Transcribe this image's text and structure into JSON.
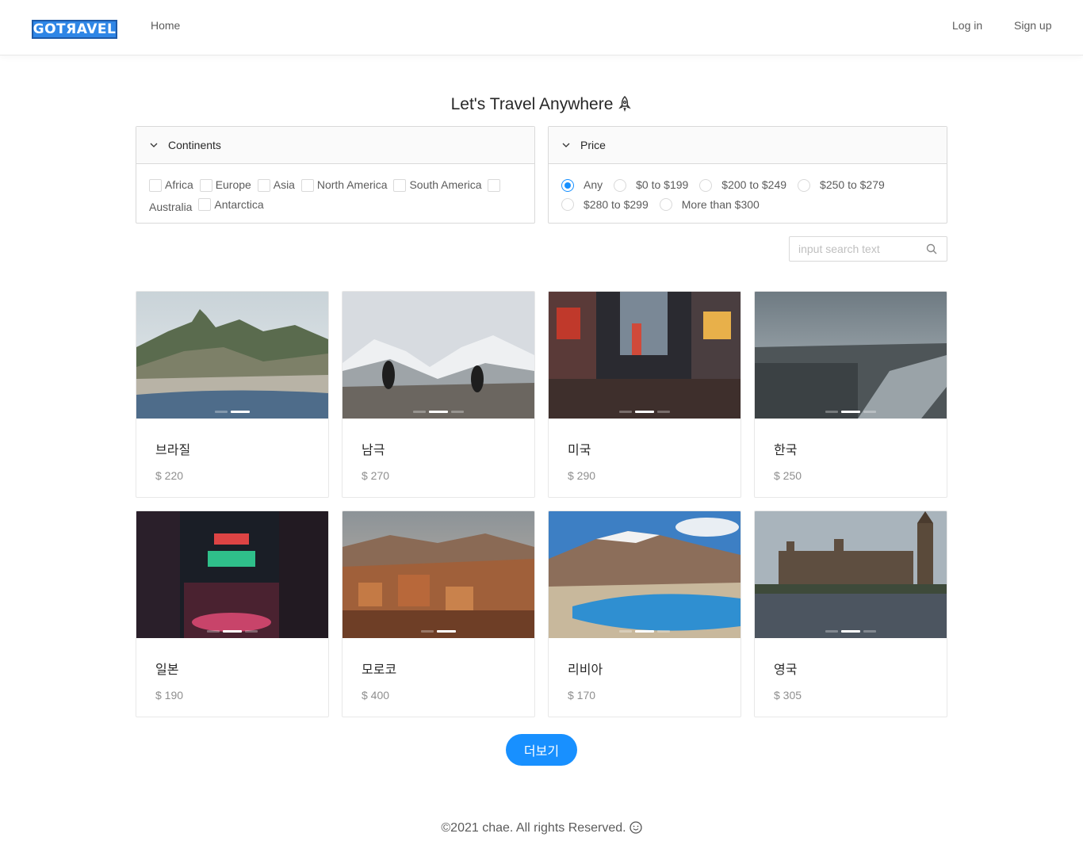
{
  "header": {
    "logo": "GOTЯAVEL",
    "home": "Home",
    "login": "Log in",
    "signup": "Sign up"
  },
  "title": "Let's Travel Anywhere",
  "continents_panel": {
    "title": "Continents",
    "options": [
      "Africa",
      "Europe",
      "Asia",
      "North America",
      "South America",
      "Australia",
      "Antarctica"
    ]
  },
  "price_panel": {
    "title": "Price",
    "options": [
      "Any",
      "$0 to $199",
      "$200 to $249",
      "$250 to $279",
      "$280 to $299",
      "More than $300"
    ],
    "selected": "Any"
  },
  "search": {
    "placeholder": "input search text"
  },
  "cards": [
    {
      "name": "브라질",
      "price": "$ 220",
      "icon": "rio-mountain-photo"
    },
    {
      "name": "남극",
      "price": "$ 270",
      "icon": "penguins-photo"
    },
    {
      "name": "미국",
      "price": "$ 290",
      "icon": "times-square-photo"
    },
    {
      "name": "한국",
      "price": "$ 250",
      "icon": "seoul-river-photo"
    },
    {
      "name": "일본",
      "price": "$ 190",
      "icon": "tokyo-night-photo"
    },
    {
      "name": "모로코",
      "price": "$ 400",
      "icon": "morocco-village-photo"
    },
    {
      "name": "리비아",
      "price": "$ 170",
      "icon": "mountain-lake-photo"
    },
    {
      "name": "영국",
      "price": "$ 305",
      "icon": "london-parliament-photo"
    }
  ],
  "more_button": "더보기",
  "footer": "©2021 chae. All rights Reserved.",
  "colors": {
    "primary": "#1890ff",
    "logo_bg": "#2f86e6"
  }
}
